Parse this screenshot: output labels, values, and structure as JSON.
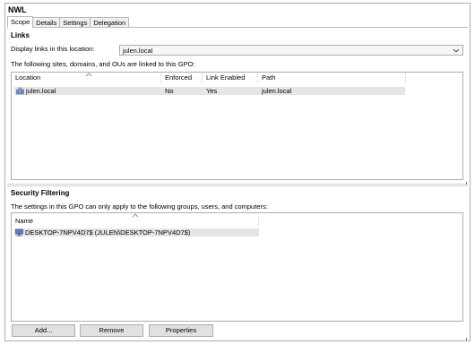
{
  "gpo_name": "NWL",
  "tabs": [
    {
      "label": "Scope"
    },
    {
      "label": "Details"
    },
    {
      "label": "Settings"
    },
    {
      "label": "Delegation"
    }
  ],
  "links": {
    "section_title": "Links",
    "display_label": "Display links in this location:",
    "location_value": "julen.local",
    "linked_text": "The following sites, domains, and OUs are linked to this GPO:",
    "columns": [
      "Location",
      "Enforced",
      "Link Enabled",
      "Path"
    ],
    "rows": [
      {
        "location": "julen.local",
        "enforced": "No",
        "link_enabled": "Yes",
        "path": "julen.local",
        "icon": "domain-icon"
      }
    ]
  },
  "security_filtering": {
    "section_title": "Security Filtering",
    "description": "The settings in this GPO can only apply to the following groups, users, and computers:",
    "columns": [
      "Name"
    ],
    "rows": [
      {
        "name": "DESKTOP-7NPV4D7$ (JULEN\\DESKTOP-7NPV4D7$)",
        "icon": "computer-icon"
      }
    ]
  },
  "buttons": {
    "add": "Add...",
    "remove": "Remove",
    "properties": "Properties"
  }
}
